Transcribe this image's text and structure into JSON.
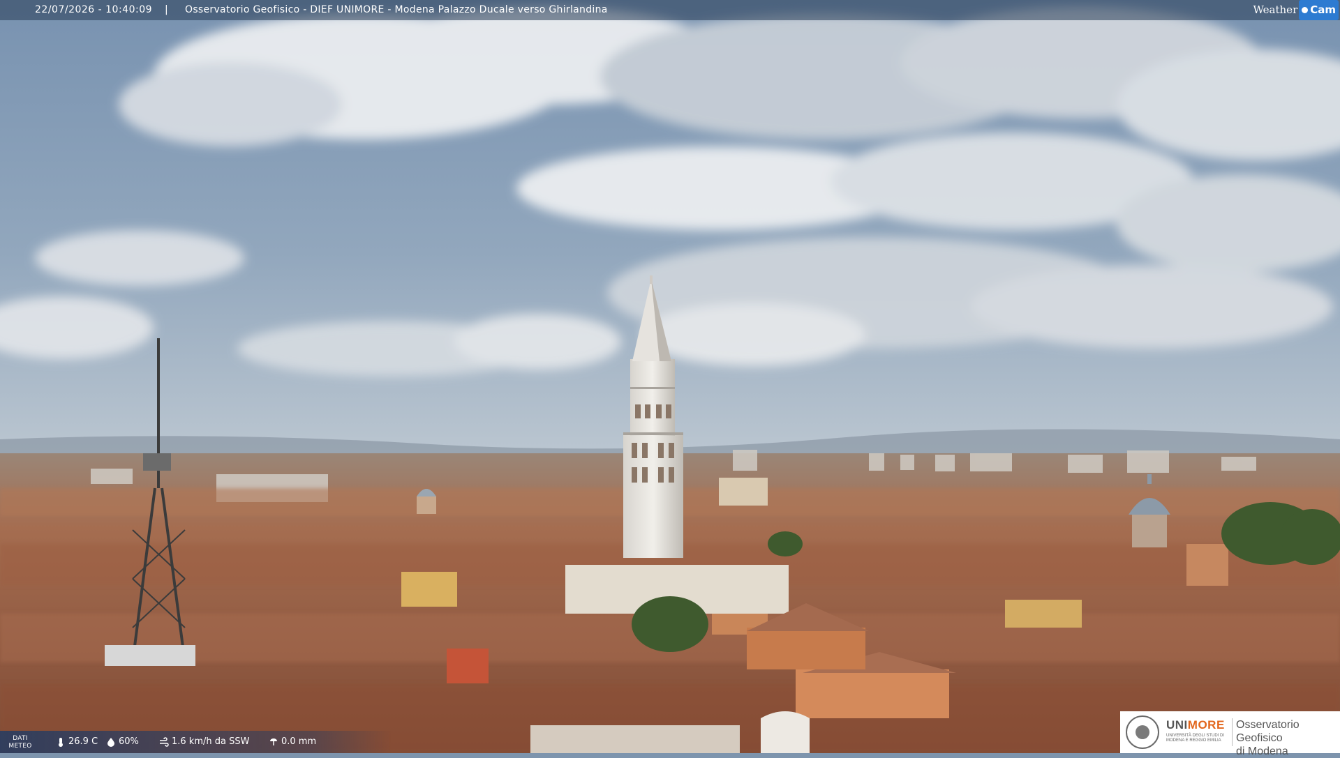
{
  "header": {
    "timestamp": "22/07/2026 - 10:40:09",
    "separator": "|",
    "location": "Osservatorio Geofisico - DIEF UNIMORE - Modena Palazzo Ducale verso Ghirlandina"
  },
  "brand": {
    "weather": "Weather",
    "cam": "Cam"
  },
  "meteo": {
    "label_line1": "DATI",
    "label_line2": "METEO",
    "temperature": "26.9 C",
    "humidity": "60%",
    "wind": "1.6 km/h da SSW",
    "rain": "0.0 mm"
  },
  "logo": {
    "uni_a": "UNI",
    "uni_b": "MORE",
    "uni_sub": "UNIVERSITÀ DEGLI STUDI DI MODENA E REGGIO EMILIA",
    "observatory_line1": "Osservatorio Geofisico",
    "observatory_line2": "di Modena"
  },
  "colors": {
    "sky_top": "#7e98b6",
    "sky_horizon": "#b9c6d3",
    "roofs": "#a0664a",
    "tower": "#e3e1dc",
    "accent_orange": "#e2651b",
    "cam_blue": "#2d7bd1"
  },
  "icons": [
    "thermometer-icon",
    "humidity-icon",
    "wind-icon",
    "rain-icon",
    "university-seal-icon"
  ]
}
